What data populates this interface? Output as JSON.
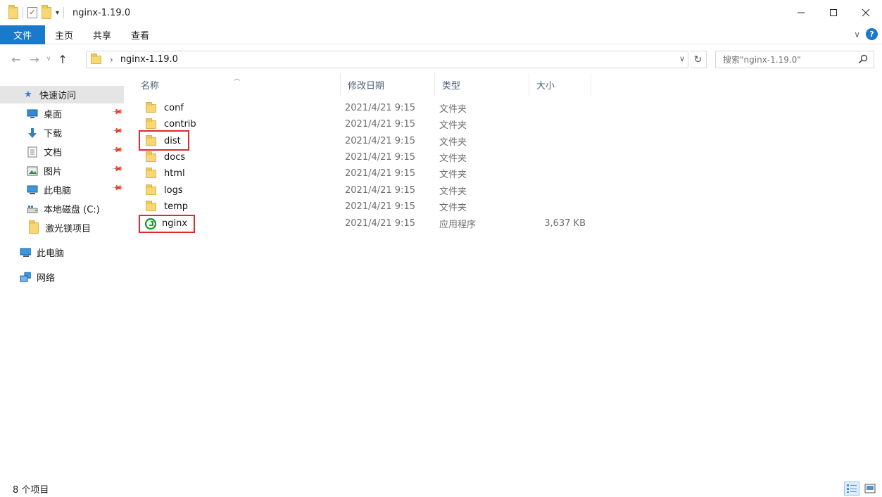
{
  "window": {
    "title": "nginx-1.19.0",
    "min_icon": "minimize-icon",
    "max_icon": "maximize-icon",
    "close_icon": "close-icon"
  },
  "ribbon": {
    "tabs": [
      "文件",
      "主页",
      "共享",
      "查看"
    ]
  },
  "address": {
    "path": "nginx-1.19.0",
    "search_placeholder": "搜索\"nginx-1.19.0\""
  },
  "sidebar": {
    "items": [
      {
        "label": "快速访问",
        "icon": "star-icon"
      },
      {
        "label": "桌面",
        "icon": "desktop-icon"
      },
      {
        "label": "下载",
        "icon": "download-icon"
      },
      {
        "label": "文档",
        "icon": "document-icon"
      },
      {
        "label": "图片",
        "icon": "pictures-icon"
      },
      {
        "label": "此电脑",
        "icon": "computer-icon"
      },
      {
        "label": "本地磁盘 (C:)",
        "icon": "drive-icon"
      },
      {
        "label": "激光镁项目",
        "icon": "folder-icon"
      },
      {
        "label": "此电脑",
        "icon": "computer-icon"
      },
      {
        "label": "网络",
        "icon": "network-icon"
      }
    ]
  },
  "columns": {
    "name": "名称",
    "date": "修改日期",
    "type": "类型",
    "size": "大小"
  },
  "files": [
    {
      "name": "conf",
      "date": "2021/4/21 9:15",
      "type": "文件夹",
      "size": ""
    },
    {
      "name": "contrib",
      "date": "2021/4/21 9:15",
      "type": "文件夹",
      "size": ""
    },
    {
      "name": "dist",
      "date": "2021/4/21 9:15",
      "type": "文件夹",
      "size": ""
    },
    {
      "name": "docs",
      "date": "2021/4/21 9:15",
      "type": "文件夹",
      "size": ""
    },
    {
      "name": "html",
      "date": "2021/4/21 9:15",
      "type": "文件夹",
      "size": ""
    },
    {
      "name": "logs",
      "date": "2021/4/21 9:15",
      "type": "文件夹",
      "size": ""
    },
    {
      "name": "temp",
      "date": "2021/4/21 9:15",
      "type": "文件夹",
      "size": ""
    },
    {
      "name": "nginx",
      "date": "2021/4/21 9:15",
      "type": "应用程序",
      "size": "3,637 KB"
    }
  ],
  "status": {
    "count": "8 个项目"
  },
  "colors": {
    "accent": "#1979ca",
    "highlight": "#e0282e",
    "folder": "#f8d775"
  }
}
